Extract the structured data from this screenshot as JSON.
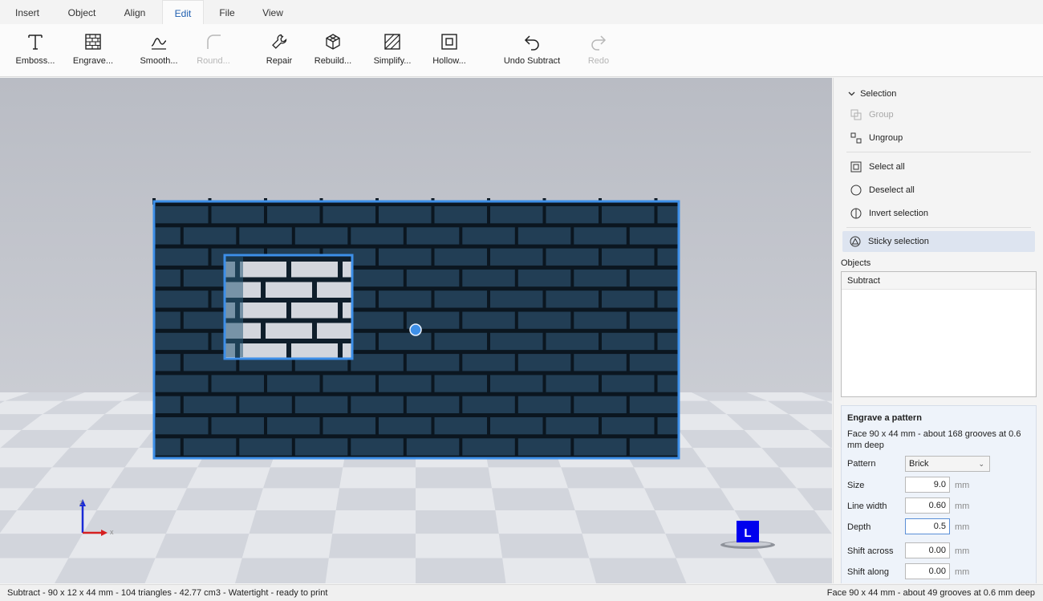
{
  "tabs": [
    "Insert",
    "Object",
    "Align",
    "Edit",
    "File",
    "View"
  ],
  "active_tab": "Edit",
  "ribbon": {
    "emboss": "Emboss...",
    "engrave": "Engrave...",
    "smooth": "Smooth...",
    "round": "Round...",
    "repair": "Repair",
    "rebuild": "Rebuild...",
    "simplify": "Simplify...",
    "hollow": "Hollow...",
    "undo": "Undo Subtract",
    "redo": "Redo"
  },
  "viewport": {
    "axis_z": "z",
    "axis_x": "x",
    "view_cube_label": "L"
  },
  "selection": {
    "header": "Selection",
    "group": "Group",
    "ungroup": "Ungroup",
    "select_all": "Select all",
    "deselect_all": "Deselect all",
    "invert_selection": "Invert selection",
    "sticky_selection": "Sticky selection"
  },
  "objects": {
    "label": "Objects",
    "items": [
      "Subtract"
    ]
  },
  "engrave_panel": {
    "title": "Engrave a pattern",
    "description": "Face 90 x 44 mm - about 168 grooves at 0.6 mm deep",
    "pattern_label": "Pattern",
    "pattern_value": "Brick",
    "size_label": "Size",
    "size_value": "9.0",
    "line_width_label": "Line width",
    "line_width_value": "0.60",
    "depth_label": "Depth",
    "depth_value": "0.5",
    "shift_across_label": "Shift across",
    "shift_across_value": "0.00",
    "shift_along_label": "Shift along",
    "shift_along_value": "0.00",
    "unit": "mm"
  },
  "status": {
    "left": "Subtract - 90 x 12 x 44 mm - 104 triangles - 42.77 cm3 - Watertight - ready to print",
    "right": "Face 90 x 44 mm - about 49 grooves at 0.6 mm deep"
  },
  "colors": {
    "accent": "#1f5fb0",
    "selection_highlight": "#3d8fe8",
    "wall": "#223e55",
    "mortar": "#0b1620",
    "window_brick": "#d3d6dd"
  }
}
